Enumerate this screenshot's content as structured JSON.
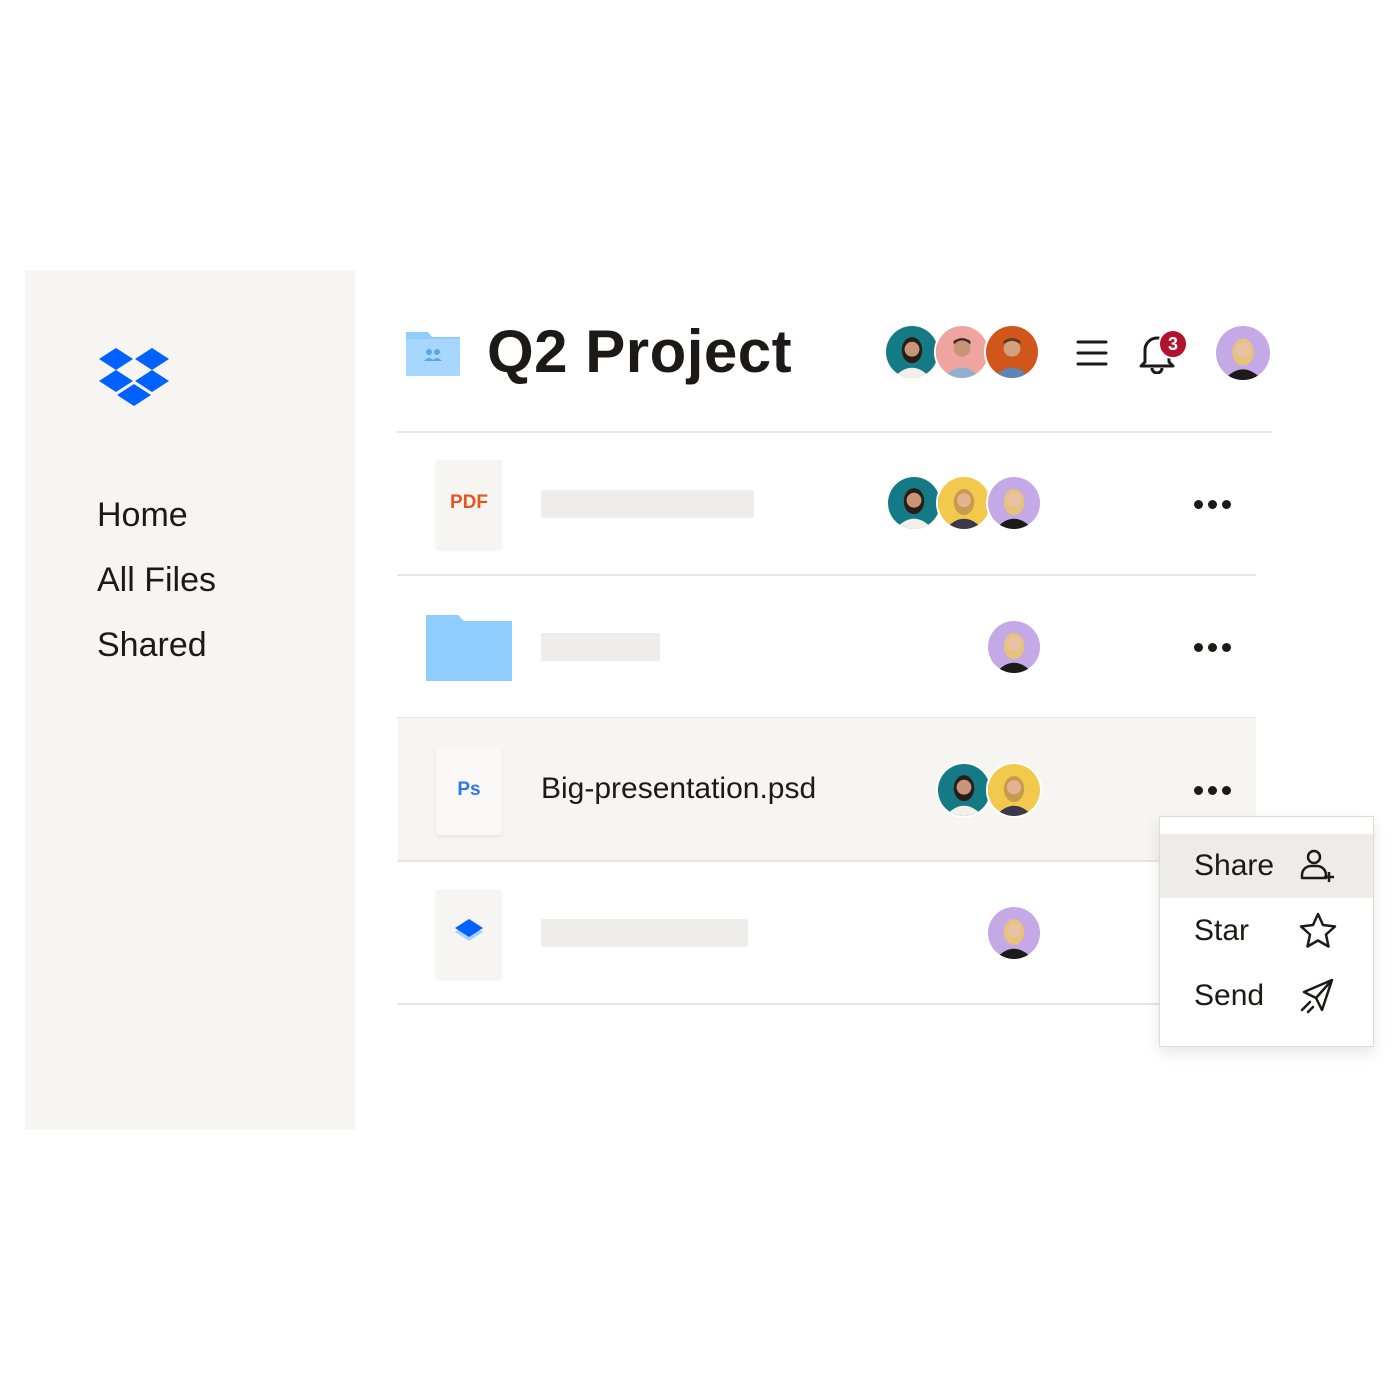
{
  "sidebar": {
    "logo_icon": "dropbox-logo",
    "items": [
      {
        "label": "Home"
      },
      {
        "label": "All Files"
      },
      {
        "label": "Shared"
      }
    ]
  },
  "header": {
    "folder_icon": "shared-folder-icon",
    "title": "Q2 Project",
    "notification_count": "3"
  },
  "files": [
    {
      "type_label": "PDF",
      "name": "",
      "collaborators": 3
    },
    {
      "type_label": "",
      "name": "",
      "collaborators": 1
    },
    {
      "type_label": "Ps",
      "name": "Big-presentation.psd",
      "collaborators": 2,
      "selected": true
    },
    {
      "type_label": "",
      "name": "",
      "collaborators": 1
    }
  ],
  "context_menu": {
    "items": [
      {
        "label": "Share",
        "icon": "add-person-icon"
      },
      {
        "label": "Star",
        "icon": "star-icon"
      },
      {
        "label": "Send",
        "icon": "send-icon"
      }
    ]
  },
  "colors": {
    "brand_blue": "#0061fe",
    "folder_blue": "#90cdff",
    "pdf_orange": "#e2571e",
    "ps_blue": "#2a7be0",
    "badge_red": "#b3122e",
    "sidebar_bg": "#f7f5f2"
  }
}
